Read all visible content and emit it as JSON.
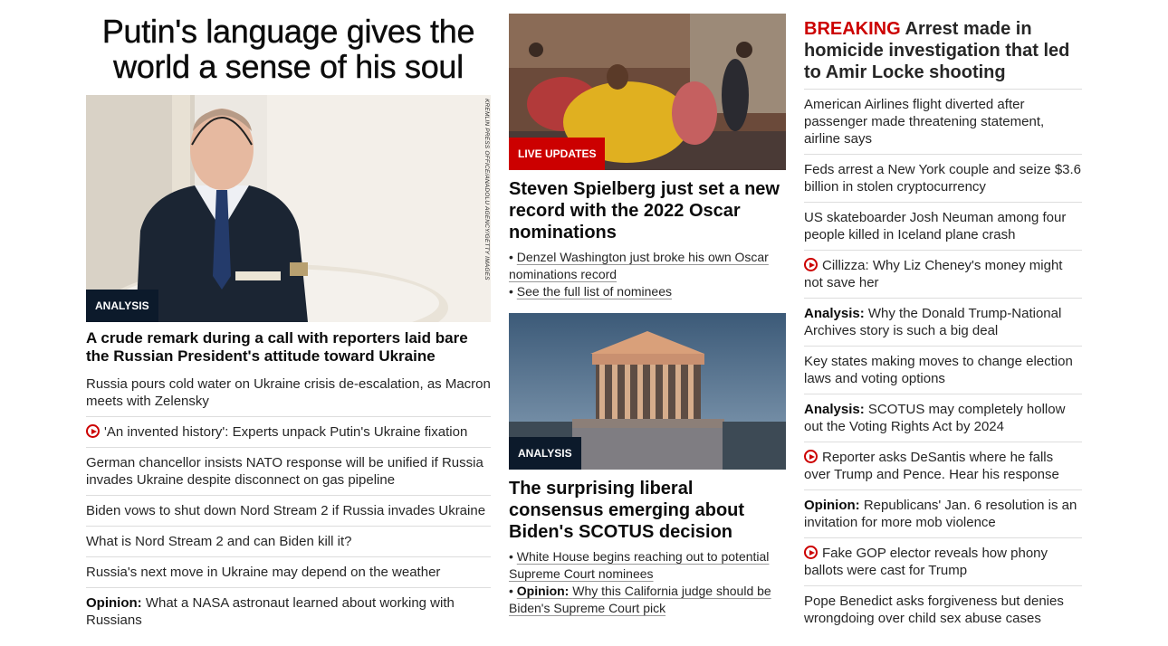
{
  "col1": {
    "hero_title": "Putin's language gives the world a sense of his soul",
    "photo_credit": "KREMLIN PRESS OFFICE/ANADOLU AGENCY/GETTY IMAGES",
    "badge": "ANALYSIS",
    "lead_headline": "A crude remark during a call with reporters laid bare the Russian President's attitude toward Ukraine",
    "items": [
      {
        "prefix": "",
        "text": "Russia pours cold water on Ukraine crisis de-escalation, as Macron meets with Zelensky",
        "video": false
      },
      {
        "prefix": "",
        "text": "'An invented history': Experts unpack Putin's Ukraine fixation",
        "video": true
      },
      {
        "prefix": "",
        "text": "German chancellor insists NATO response will be unified if Russia invades Ukraine despite disconnect on gas pipeline",
        "video": false
      },
      {
        "prefix": "",
        "text": "Biden vows to shut down Nord Stream 2 if Russia invades Ukraine",
        "video": false
      },
      {
        "prefix": "",
        "text": "What is Nord Stream 2 and can Biden kill it?",
        "video": false
      },
      {
        "prefix": "",
        "text": "Russia's next move in Ukraine may depend on the weather",
        "video": false
      },
      {
        "prefix": "Opinion:",
        "text": "What a NASA astronaut learned about working with Russians",
        "video": false
      }
    ]
  },
  "col2": {
    "story1": {
      "badge": "LIVE UPDATES",
      "headline": "Steven Spielberg just set a new record with the 2022 Oscar nominations",
      "bullets": [
        {
          "prefix": "",
          "text": "Denzel Washington just broke his own Oscar nominations record"
        },
        {
          "prefix": "",
          "text": "See the full list of nominees"
        }
      ]
    },
    "story2": {
      "badge": "ANALYSIS",
      "headline": "The surprising liberal consensus emerging about Biden's SCOTUS decision",
      "bullets": [
        {
          "prefix": "",
          "text": "White House begins reaching out to potential Supreme Court nominees"
        },
        {
          "prefix": "Opinion:",
          "text": "Why this California judge should be Biden's Supreme Court pick"
        }
      ]
    }
  },
  "col3": {
    "breaking_tag": "BREAKING",
    "breaking_text": "Arrest made in homicide investigation that led to Amir Locke shooting",
    "items": [
      {
        "prefix": "",
        "text": "American Airlines flight diverted after passenger made threatening statement, airline says",
        "video": false
      },
      {
        "prefix": "",
        "text": "Feds arrest a New York couple and seize $3.6 billion in stolen cryptocurrency",
        "video": false
      },
      {
        "prefix": "",
        "text": "US skateboarder Josh Neuman among four people killed in Iceland plane crash",
        "video": false
      },
      {
        "prefix": "",
        "text": "Cillizza: Why Liz Cheney's money might not save her",
        "video": true
      },
      {
        "prefix": "Analysis:",
        "text": "Why the Donald Trump-National Archives story is such a big deal",
        "video": false
      },
      {
        "prefix": "",
        "text": "Key states making moves to change election laws and voting options",
        "video": false
      },
      {
        "prefix": "Analysis:",
        "text": "SCOTUS may completely hollow out the Voting Rights Act by 2024",
        "video": false
      },
      {
        "prefix": "",
        "text": "Reporter asks DeSantis where he falls over Trump and Pence. Hear his response",
        "video": true
      },
      {
        "prefix": "Opinion:",
        "text": "Republicans' Jan. 6 resolution is an invitation for more mob violence",
        "video": false
      },
      {
        "prefix": "",
        "text": "Fake GOP elector reveals how phony ballots were cast for Trump",
        "video": true
      },
      {
        "prefix": "",
        "text": "Pope Benedict asks forgiveness but denies wrongdoing over child sex abuse cases",
        "video": false
      }
    ]
  },
  "colors": {
    "accent_red": "#cc0000",
    "badge_dark": "#0c1a2b",
    "divider": "#dddddd"
  }
}
